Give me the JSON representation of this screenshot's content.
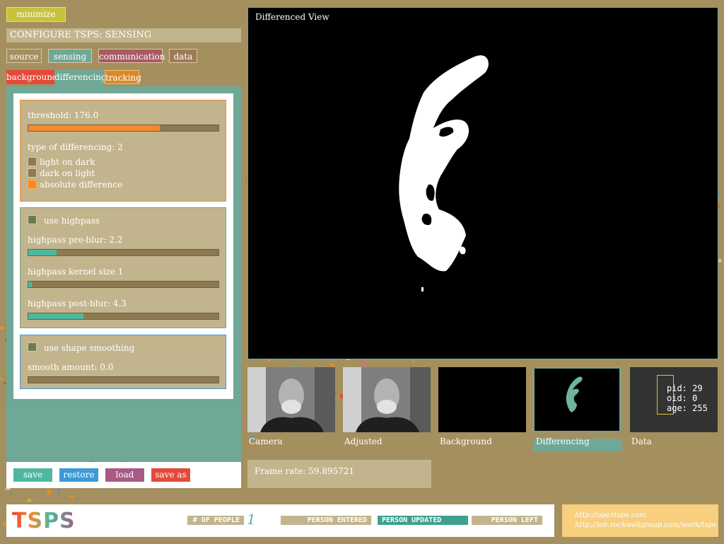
{
  "colors": {
    "background": "#a48f5f",
    "panel_teal": "#6fa896",
    "panel_tan": "#c2b48c",
    "accent_orange": "#f48a2c",
    "accent_red": "#e34a3a",
    "accent_blue": "#3a9bd6",
    "accent_purple": "#a85a85",
    "accent_teal": "#4fb79f",
    "accent_yellow": "#c8c23a"
  },
  "header": {
    "minimize_label": "minimize",
    "config_title": "CONFIGURE TSPS: SENSING"
  },
  "main_tabs": [
    {
      "label": "source"
    },
    {
      "label": "sensing"
    },
    {
      "label": "communication"
    },
    {
      "label": "data"
    }
  ],
  "sub_tabs": [
    {
      "label": "background"
    },
    {
      "label": "differencing"
    },
    {
      "label": "tracking"
    }
  ],
  "differencing_group": {
    "threshold_label": "threshold: 176.0",
    "threshold_value": 0.69,
    "type_label": "type of differencing: 2",
    "options": [
      {
        "label": "light on dark",
        "checked": false
      },
      {
        "label": "dark on light",
        "checked": false
      },
      {
        "label": "absolute difference",
        "checked": true
      }
    ]
  },
  "highpass_group": {
    "use_label": "use highpass",
    "enabled": false,
    "preblur_label": "highpass pre-blur: 2.2",
    "preblur_value": 0.15,
    "kernel_label": "highpass kernel size 1",
    "kernel_value": 0.02,
    "postblur_label": "highpass post-blur: 4.3",
    "postblur_value": 0.29
  },
  "smoothing_group": {
    "use_label": "use shape smoothing",
    "enabled": false,
    "amount_label": "smooth amount: 0.0",
    "amount_value": 0.0
  },
  "actions": [
    {
      "label": "save"
    },
    {
      "label": "restore"
    },
    {
      "label": "load"
    },
    {
      "label": "save as"
    }
  ],
  "view": {
    "title": "Differenced View"
  },
  "thumbnails": [
    {
      "label": "Camera"
    },
    {
      "label": "Adjusted"
    },
    {
      "label": "Background"
    },
    {
      "label": "Differencing"
    },
    {
      "label": "Data"
    }
  ],
  "data_overlay": {
    "pid": "pid: 29",
    "oid": "oid: 0",
    "age": "age: 255"
  },
  "frame_rate": "Frame rate: 59.895721",
  "footer": {
    "logo": "TSPS",
    "people_label": "# OF PEOPLE",
    "people_count": "1",
    "entered": "PERSON ENTERED",
    "updated": "PERSON UPDATED",
    "left": "PERSON LEFT",
    "url1": "http://opentsps.com",
    "url2": "http://lab.rockwellgroup.com/work/tsps"
  }
}
